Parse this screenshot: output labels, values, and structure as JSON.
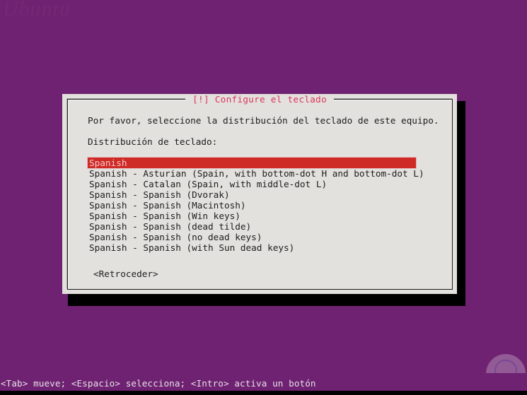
{
  "desktop": {
    "background_color": "#6e2271",
    "watermark_text": "Ubuntu",
    "logo_icon": "lightbulb-q-logo-icon"
  },
  "dialog": {
    "title": "[!] Configure el teclado",
    "title_color": "#d8385c",
    "background_color": "#e3e1de",
    "prompt": "Por favor, seleccione la distribución del teclado de este equipo.",
    "list_label": "Distribución de teclado:",
    "selected_index": 0,
    "selection_color": "#cf2b26",
    "items": [
      "Spanish",
      "Spanish - Asturian (Spain, with bottom-dot H and bottom-dot L)",
      "Spanish - Catalan (Spain, with middle-dot L)",
      "Spanish - Spanish (Dvorak)",
      "Spanish - Spanish (Macintosh)",
      "Spanish - Spanish (Win keys)",
      "Spanish - Spanish (dead tilde)",
      "Spanish - Spanish (no dead keys)",
      "Spanish - Spanish (with Sun dead keys)"
    ],
    "back_button": "<Retroceder>"
  },
  "status_bar": {
    "text": "<Tab> mueve; <Espacio> selecciona; <Intro> activa un botón"
  }
}
